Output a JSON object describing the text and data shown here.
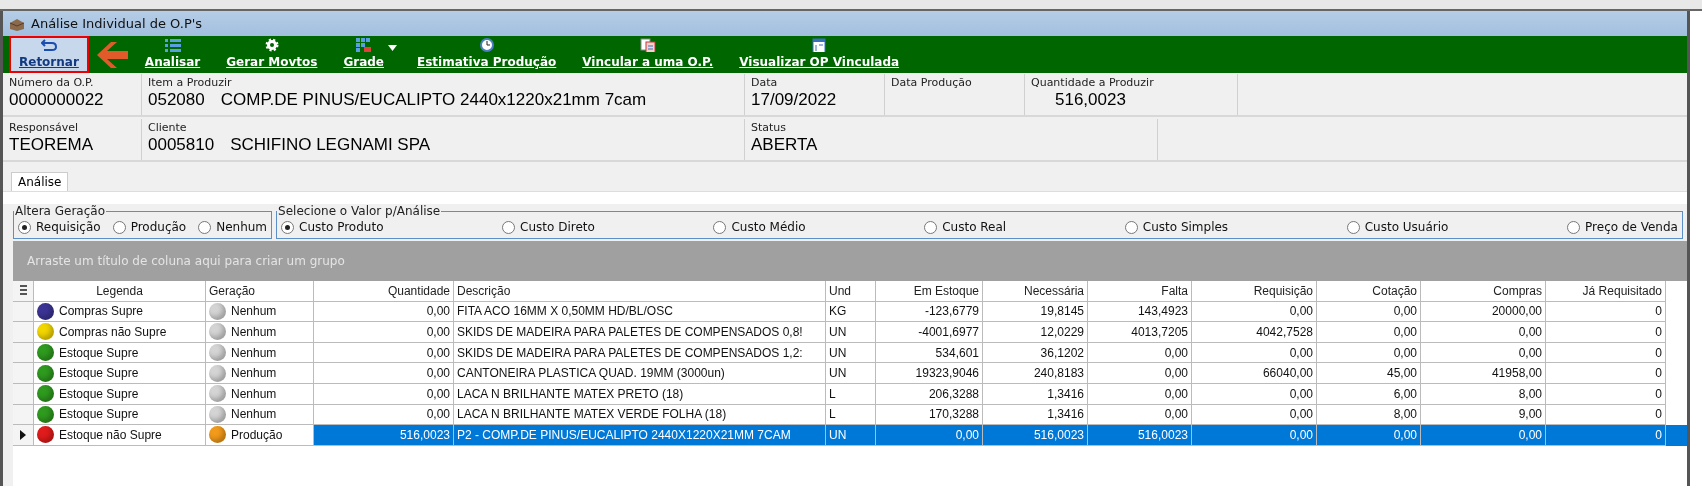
{
  "window": {
    "title": "Análise Individual de O.P's"
  },
  "toolbar": [
    {
      "kind": "back",
      "label": "Retornar",
      "highlighted": true
    },
    {
      "kind": "list",
      "label": "Analisar",
      "highlighted": false
    },
    {
      "kind": "gear",
      "label": "Gerar Movtos",
      "highlighted": false
    },
    {
      "kind": "grid",
      "label": "Grade",
      "highlighted": false,
      "dropdown": true
    },
    {
      "kind": "clock",
      "label": "Estimativa Produção",
      "highlighted": false
    },
    {
      "kind": "link",
      "label": "Vincular a uma O.P.",
      "highlighted": false
    },
    {
      "kind": "doc",
      "label": "Visualizar OP Vinculada",
      "highlighted": false
    }
  ],
  "header_rows": [
    [
      {
        "label": "Número da O.P.",
        "value": "0000000022"
      },
      {
        "label": "Item a Produzir",
        "value": "052080",
        "extra": "COMP.DE PINUS/EUCALIPTO 2440x1220x21mm 7cam"
      },
      {
        "label": "Data",
        "value": "17/09/2022"
      },
      {
        "label": "Data Produção"
      },
      {
        "label": "Quantidade a Produzir",
        "value": "516,0023"
      }
    ],
    [
      {
        "label": "Responsável",
        "value": "TEOREMA"
      },
      {
        "label": "Cliente",
        "value": "0005810",
        "extra": "SCHIFINO LEGNAMI SPA"
      },
      {
        "label": "Status",
        "value": "ABERTA"
      }
    ]
  ],
  "tabs": [
    {
      "label": "Análise",
      "selected": true
    }
  ],
  "altera_geracao": {
    "title": "Altera Geração",
    "options": [
      {
        "label": "Requisição",
        "selected": true
      },
      {
        "label": "Produção",
        "selected": false
      },
      {
        "label": "Nenhum",
        "selected": false
      }
    ]
  },
  "valor_analise": {
    "title": "Selecione o Valor p/Análise",
    "options": [
      {
        "label": "Custo Produto",
        "selected": true
      },
      {
        "label": "Custo Direto",
        "selected": false
      },
      {
        "label": "Custo Médio",
        "selected": false
      },
      {
        "label": "Custo Real",
        "selected": false
      },
      {
        "label": "Custo Simples",
        "selected": false
      },
      {
        "label": "Custo Usuário",
        "selected": false
      },
      {
        "label": "Preço de Venda",
        "selected": false
      }
    ]
  },
  "group_panel": {
    "hint": "Arraste um título de coluna aqui para criar um grupo"
  },
  "table": {
    "columns": [
      "Legenda",
      "Geração",
      "Quantidade",
      "Descrição",
      "Und",
      "Em Estoque",
      "Necessária",
      "Falta",
      "Requisição",
      "Cotação",
      "Compras",
      "Já Requisitado"
    ],
    "rows": [
      {
        "selected": false,
        "dots": [
          {
            "color": "#3b3494"
          },
          {
            "color": "#d4d4d4"
          }
        ],
        "cells": [
          "Compras Supre",
          "Nenhum",
          "0,00",
          "FITA ACO 16MM X 0,50MM HD/BL/OSC",
          "KG",
          "-123,6779",
          "19,8145",
          "143,4923",
          "0,00",
          "0,00",
          "20000,00",
          "0"
        ]
      },
      {
        "selected": false,
        "dots": [
          {
            "color": "#f2d600"
          },
          {
            "color": "#d4d4d4"
          }
        ],
        "cells": [
          "Compras não Supre",
          "Nenhum",
          "0,00",
          "SKIDS DE MADEIRA PARA PALETES DE COMPENSADOS 0,8!",
          "UN",
          "-4001,6977",
          "12,0229",
          "4013,7205",
          "4042,7528",
          "0,00",
          "0,00",
          "0"
        ]
      },
      {
        "selected": false,
        "dots": [
          {
            "color": "#2e9a1e"
          },
          {
            "color": "#d4d4d4"
          }
        ],
        "cells": [
          "Estoque Supre",
          "Nenhum",
          "0,00",
          "SKIDS DE MADEIRA PARA PALETES DE COMPENSADOS 1,2:",
          "UN",
          "534,601",
          "36,1202",
          "0,00",
          "0,00",
          "0,00",
          "0,00",
          "0"
        ]
      },
      {
        "selected": false,
        "dots": [
          {
            "color": "#2e9a1e"
          },
          {
            "color": "#d4d4d4"
          }
        ],
        "cells": [
          "Estoque Supre",
          "Nenhum",
          "0,00",
          "CANTONEIRA PLASTICA QUAD.  19MM (3000un)",
          "UN",
          "19323,9046",
          "240,8183",
          "0,00",
          "66040,00",
          "45,00",
          "41958,00",
          "0"
        ]
      },
      {
        "selected": false,
        "dots": [
          {
            "color": "#2e9a1e"
          },
          {
            "color": "#d4d4d4"
          }
        ],
        "cells": [
          "Estoque Supre",
          "Nenhum",
          "0,00",
          "LACA N BRILHANTE MATEX PRETO (18)",
          "L",
          "206,3288",
          "1,3416",
          "0,00",
          "0,00",
          "6,00",
          "8,00",
          "0"
        ]
      },
      {
        "selected": false,
        "dots": [
          {
            "color": "#2e9a1e"
          },
          {
            "color": "#d4d4d4"
          }
        ],
        "cells": [
          "Estoque Supre",
          "Nenhum",
          "0,00",
          "LACA N BRILHANTE MATEX VERDE FOLHA (18)",
          "L",
          "170,3288",
          "1,3416",
          "0,00",
          "0,00",
          "8,00",
          "9,00",
          "0"
        ]
      },
      {
        "selected": true,
        "dots": [
          {
            "color": "#e01b1b"
          },
          {
            "color": "#f29a1a"
          }
        ],
        "cells": [
          "Estoque não Supre",
          "Produção",
          "516,0023",
          "P2 - COMP.DE PINUS/EUCALIPTO 2440X1220X21MM 7CAM",
          "UN",
          "0,00",
          "516,0023",
          "516,0023",
          "0,00",
          "0,00",
          "0,00",
          "0"
        ]
      }
    ]
  }
}
